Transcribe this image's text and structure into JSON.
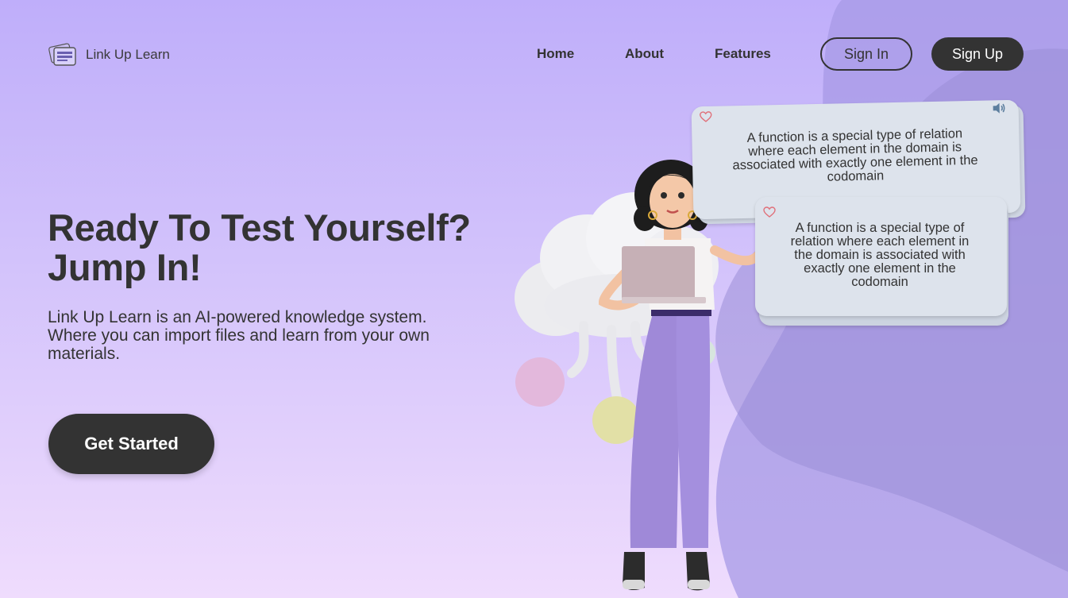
{
  "brand": {
    "name": "Link Up Learn",
    "logo_icon": "stacked-cards-icon"
  },
  "nav": {
    "links": [
      {
        "label": "Home"
      },
      {
        "label": "About"
      },
      {
        "label": "Features"
      }
    ],
    "sign_in": "Sign In",
    "sign_up": "Sign Up"
  },
  "hero": {
    "title_line1": "Ready To Test Yourself?",
    "title_line2": "Jump In!",
    "description": "Link Up Learn is an AI-powered knowledge system. Where you can import files and learn from your own materials.",
    "cta": "Get Started"
  },
  "flashcards": {
    "back_card_text": "A function is a special type of relation where each element in the domain is associated with exactly one element in the codomain",
    "front_card_text": "A function is a special type of relation where each element in the domain is associated with exactly one element in the codomain",
    "icons": [
      "heart-icon",
      "speaker-icon"
    ]
  },
  "colors": {
    "primary_dark": "#333333",
    "background_top": "#bfaefa",
    "background_bottom": "#efdcfd",
    "card": "#dde3ec"
  }
}
